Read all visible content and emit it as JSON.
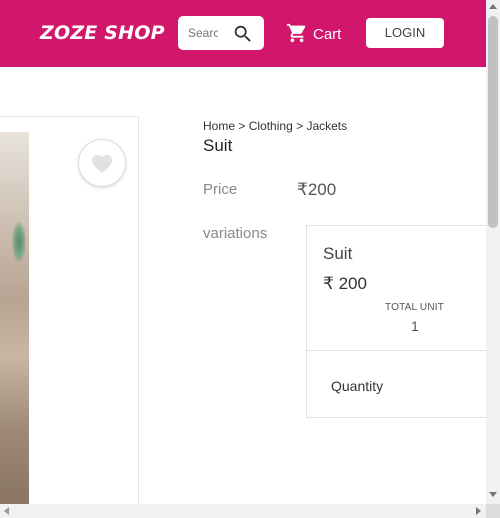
{
  "header": {
    "logo": "ZOZE SHOP",
    "search_placeholder": "Search",
    "cart_label": "Cart",
    "login_label": "LOGIN",
    "brand_color": "#d1166b"
  },
  "breadcrumb": {
    "home": "Home",
    "sep1": ">",
    "category": "Clothing",
    "sep2": ">",
    "subcategory": "Jackets"
  },
  "product": {
    "title": "Suit",
    "price_label": "Price",
    "price": "₹200",
    "variations_label": "variations"
  },
  "variation": {
    "name": "Suit",
    "currency": "₹",
    "price": "200",
    "total_unit_label": "TOTAL UNIT",
    "total_unit": "1"
  },
  "quantity": {
    "label": "Quantity"
  },
  "icons": {
    "search": "search-icon",
    "cart": "cart-icon",
    "favorite": "heart-icon"
  }
}
